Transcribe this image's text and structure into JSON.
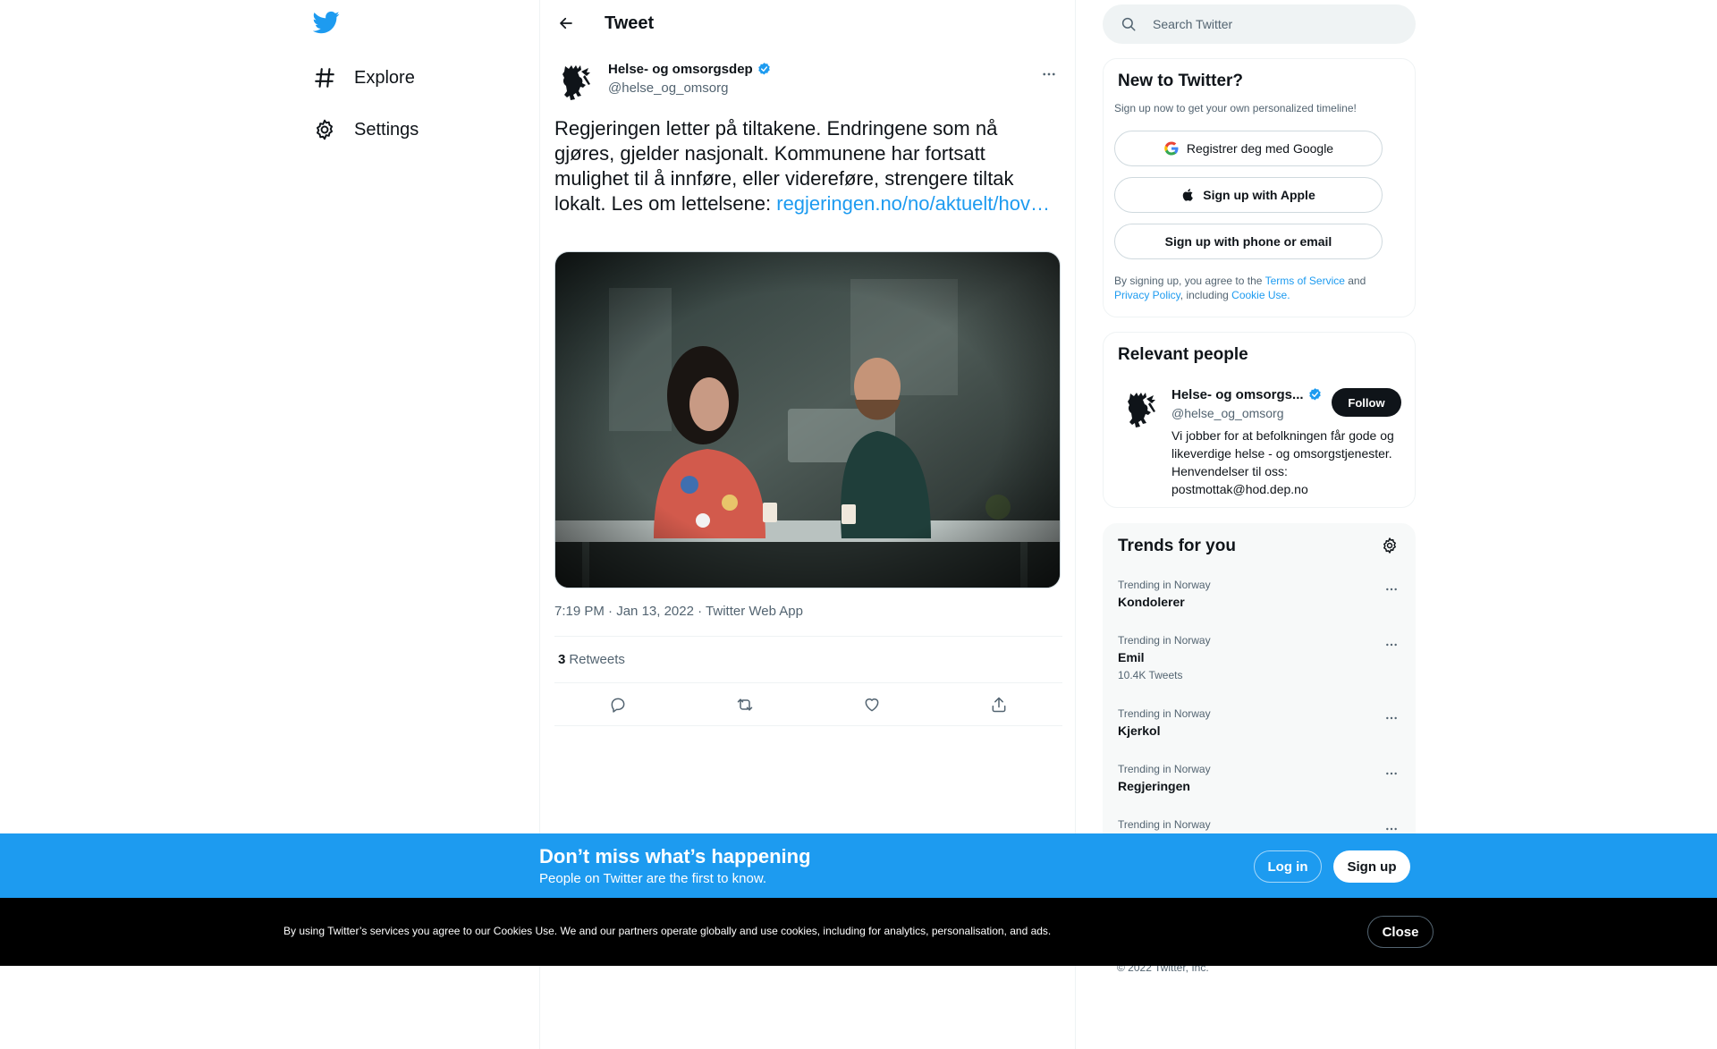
{
  "colors": {
    "accent": "#1d9bf0",
    "text_primary": "#0f1419",
    "text_secondary": "#536471",
    "border": "#eff3f4",
    "banner_blue": "#1d9bf0",
    "cookie_bg": "#000000"
  },
  "icons": {
    "logo": "twitter-bird-icon",
    "explore": "hashtag-icon",
    "settings": "gear-icon",
    "back": "arrow-left-icon",
    "more": "more-dots-icon",
    "verified": "verified-badge-icon",
    "reply": "reply-icon",
    "retweet": "retweet-icon",
    "like": "heart-icon",
    "share": "share-icon",
    "search": "search-icon",
    "google": "google-icon",
    "apple": "apple-icon"
  },
  "nav": {
    "items": [
      {
        "label": "Explore"
      },
      {
        "label": "Settings"
      }
    ]
  },
  "header": {
    "title": "Tweet"
  },
  "tweet": {
    "author_name": "Helse- og omsorgsdep",
    "author_handle": "@helse_og_omsorg",
    "text": "Regjeringen letter på tiltakene. Endringene som nå gjøres, gjelder nasjonalt. Kommunene har fortsatt mulighet til å innføre, eller videreføre, strengere tiltak lokalt. Les om lettelsene: ",
    "link_text": "regjeringen.no/no/aktuelt/hov…",
    "time": "7:19 PM",
    "date": "Jan 13, 2022",
    "source": "Twitter Web App",
    "separator": " · ",
    "retweet_count": "3",
    "retweet_label": "Retweets"
  },
  "search": {
    "placeholder": "Search Twitter"
  },
  "new_to_twitter": {
    "title": "New to Twitter?",
    "subtitle": "Sign up now to get your own personalized timeline!",
    "google_label": "Registrer deg med Google",
    "apple_label": "Sign up with Apple",
    "phone_label": "Sign up with phone or email",
    "legal_prefix": "By signing up, you agree to the ",
    "terms_label": "Terms of Service",
    "legal_and": " and ",
    "privacy_label": "Privacy Policy",
    "legal_including": ", including ",
    "cookie_label": "Cookie Use."
  },
  "relevant_people": {
    "title": "Relevant people",
    "name": "Helse- og omsorgs...",
    "handle": "@helse_og_omsorg",
    "follow_label": "Follow",
    "bio": "Vi jobber for at befolkningen får gode og likeverdige helse - og omsorgstjenester. Henvendelser til oss: postmottak@hod.dep.no"
  },
  "trends": {
    "title": "Trends for you",
    "items": [
      {
        "context": "Trending in Norway",
        "name": "Kondolerer",
        "count": ""
      },
      {
        "context": "Trending in Norway",
        "name": "Emil",
        "count": "10.4K Tweets"
      },
      {
        "context": "Trending in Norway",
        "name": "Kjerkol",
        "count": ""
      },
      {
        "context": "Trending in Norway",
        "name": "Regjeringen",
        "count": ""
      },
      {
        "context": "Trending in Norway",
        "name": "",
        "count": ""
      }
    ]
  },
  "footer": {
    "copyright": "© 2022 Twitter, Inc."
  },
  "promo": {
    "title": "Don’t miss what’s happening",
    "subtitle": "People on Twitter are the first to know.",
    "login_label": "Log in",
    "signup_label": "Sign up"
  },
  "cookie_banner": {
    "text": "By using Twitter’s services you agree to our Cookies Use. We and our partners operate globally and use cookies, including for analytics, personalisation, and ads.",
    "close_label": "Close"
  }
}
